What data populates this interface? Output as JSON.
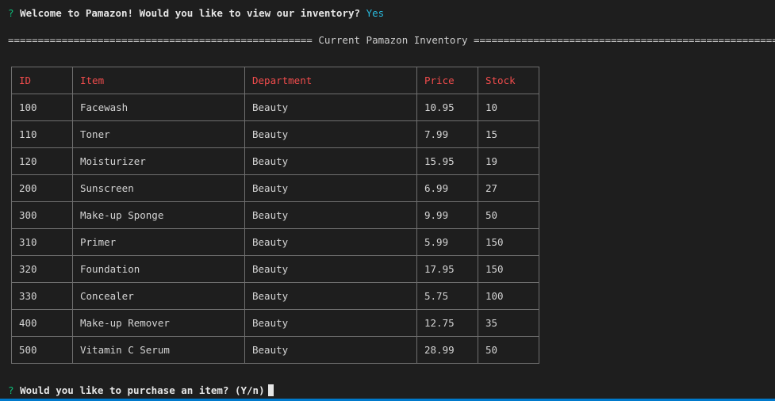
{
  "colors": {
    "background": "#1e1e1e",
    "prompt_mark": "#0dbc79",
    "answer": "#29b8db",
    "header_text": "#f14c4c",
    "statusbar": "#007acc"
  },
  "prompt1": {
    "mark": "?",
    "question": "Welcome to Pamazon! Would you like to view our inventory?",
    "answer": "Yes"
  },
  "banner": "=================================================== Current Pamazon Inventory ===================================================",
  "table": {
    "headers": [
      "ID",
      "Item",
      "Department",
      "Price",
      "Stock"
    ],
    "rows": [
      [
        "100",
        "Facewash",
        "Beauty",
        "10.95",
        "10"
      ],
      [
        "110",
        "Toner",
        "Beauty",
        "7.99",
        "15"
      ],
      [
        "120",
        "Moisturizer",
        "Beauty",
        "15.95",
        "19"
      ],
      [
        "200",
        "Sunscreen",
        "Beauty",
        "6.99",
        "27"
      ],
      [
        "300",
        "Make-up Sponge",
        "Beauty",
        "9.99",
        "50"
      ],
      [
        "310",
        "Primer",
        "Beauty",
        "5.99",
        "150"
      ],
      [
        "320",
        "Foundation",
        "Beauty",
        "17.95",
        "150"
      ],
      [
        "330",
        "Concealer",
        "Beauty",
        "5.75",
        "100"
      ],
      [
        "400",
        "Make-up Remover",
        "Beauty",
        "12.75",
        "35"
      ],
      [
        "500",
        "Vitamin C Serum",
        "Beauty",
        "28.99",
        "50"
      ]
    ]
  },
  "prompt2": {
    "mark": "?",
    "question": "Would you like to purchase an item? (Y/n)"
  }
}
